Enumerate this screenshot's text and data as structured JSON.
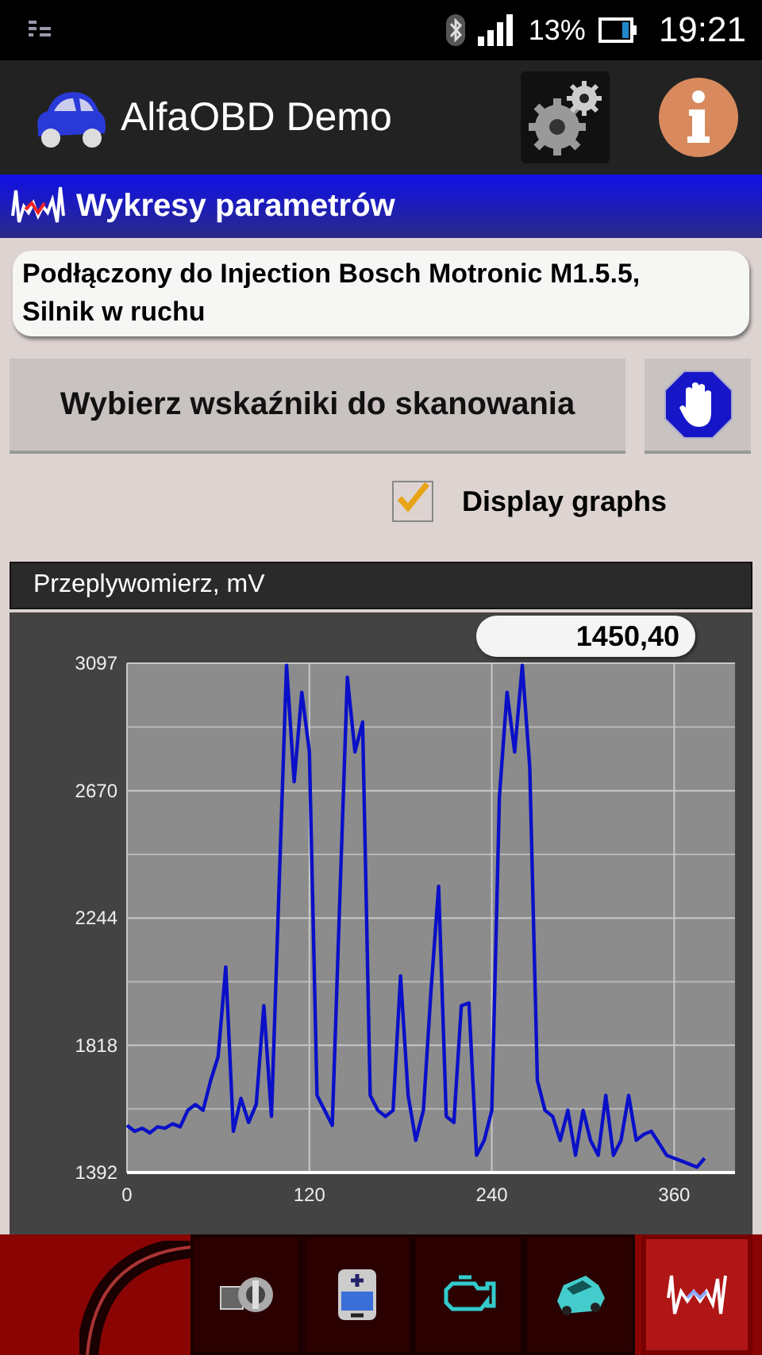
{
  "status_bar": {
    "battery": "13%",
    "time": "19:21"
  },
  "app_bar": {
    "title": "AlfaOBD Demo"
  },
  "section_title": "Wykresy parametrów",
  "connection_status": "Podłączony do Injection Bosch Motronic M1.5.5, Silnik w ruchu",
  "select_button": "Wybierz wskaźniki do skanowania",
  "display_graphs": {
    "label": "Display graphs",
    "checked": true
  },
  "graph": {
    "title": "Przeplywomierz, mV",
    "current_value": "1450,40",
    "chart_data": {
      "type": "line",
      "grid": true,
      "xlim": [
        0,
        400
      ],
      "ylim": [
        1392,
        3097
      ],
      "xticks": [
        0,
        120,
        240,
        360
      ],
      "yticks": [
        1392,
        1818,
        2244,
        2670,
        3097
      ],
      "x": [
        0,
        5,
        10,
        15,
        20,
        25,
        30,
        35,
        40,
        45,
        50,
        55,
        60,
        65,
        70,
        75,
        80,
        85,
        90,
        95,
        100,
        105,
        110,
        115,
        120,
        125,
        130,
        135,
        140,
        145,
        150,
        155,
        160,
        165,
        170,
        175,
        180,
        185,
        190,
        195,
        200,
        205,
        210,
        215,
        220,
        225,
        230,
        235,
        240,
        245,
        250,
        255,
        260,
        265,
        270,
        275,
        280,
        285,
        290,
        295,
        300,
        305,
        310,
        315,
        320,
        325,
        330,
        335,
        340,
        345,
        350,
        355,
        360,
        365,
        370,
        375,
        380
      ],
      "series": [
        {
          "color": "#0a10c8",
          "values": [
            1550,
            1530,
            1540,
            1525,
            1545,
            1540,
            1555,
            1545,
            1600,
            1620,
            1600,
            1700,
            1780,
            2080,
            1530,
            1640,
            1560,
            1620,
            1950,
            1580,
            2350,
            3090,
            2700,
            3000,
            2800,
            1650,
            1600,
            1550,
            2300,
            3050,
            2800,
            2900,
            1650,
            1600,
            1580,
            1600,
            2050,
            1650,
            1500,
            1600,
            2000,
            2350,
            1580,
            1560,
            1950,
            1960,
            1450,
            1500,
            1600,
            2650,
            3000,
            2800,
            3090,
            2750,
            1700,
            1600,
            1580,
            1500,
            1600,
            1450,
            1600,
            1500,
            1450,
            1650,
            1450,
            1500,
            1650,
            1500,
            1520,
            1530,
            1490,
            1450,
            1440,
            1430,
            1420,
            1410,
            1440
          ]
        }
      ]
    }
  },
  "toolbar": [
    {
      "selected": false
    },
    {
      "selected": false
    },
    {
      "selected": false
    },
    {
      "selected": false
    },
    {
      "selected": true
    }
  ]
}
